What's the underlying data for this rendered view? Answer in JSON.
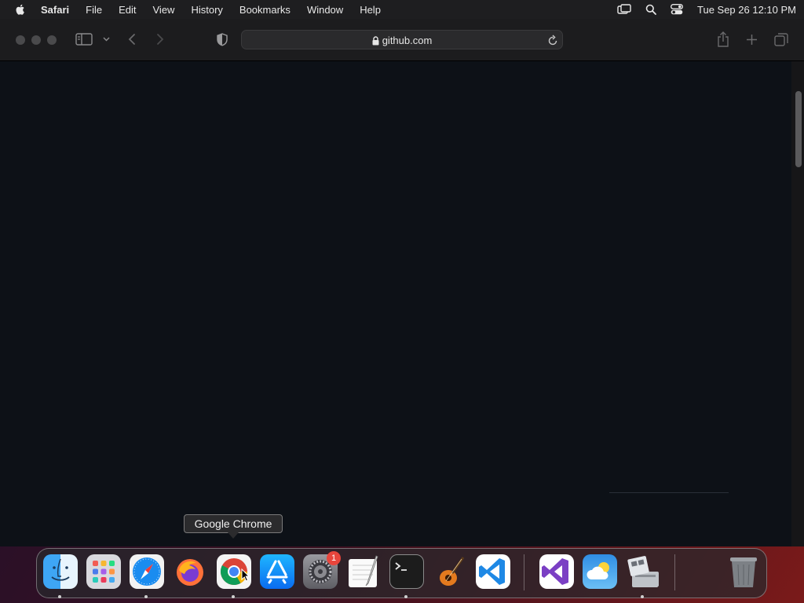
{
  "menubar": {
    "app_name": "Safari",
    "items": [
      "File",
      "Edit",
      "View",
      "History",
      "Bookmarks",
      "Window",
      "Help"
    ],
    "clock": "Tue Sep 26  12:10 PM"
  },
  "browser": {
    "address": "github.com"
  },
  "dock": {
    "tooltip": "Google Chrome",
    "settings_badge": "1",
    "apps": [
      "Finder",
      "Launchpad",
      "Safari",
      "Firefox",
      "Google Chrome",
      "App Store",
      "System Settings",
      "TextEdit",
      "Terminal",
      "GarageBand",
      "Visual Studio Code",
      "Visual Studio",
      "Weather",
      "Boot Camp Assistant",
      "Trash"
    ]
  },
  "colors": {
    "page_background": "#0d1117",
    "toolbar": "#1c1c1e",
    "menubar": "#1e1e20",
    "badge": "#e8453c"
  }
}
